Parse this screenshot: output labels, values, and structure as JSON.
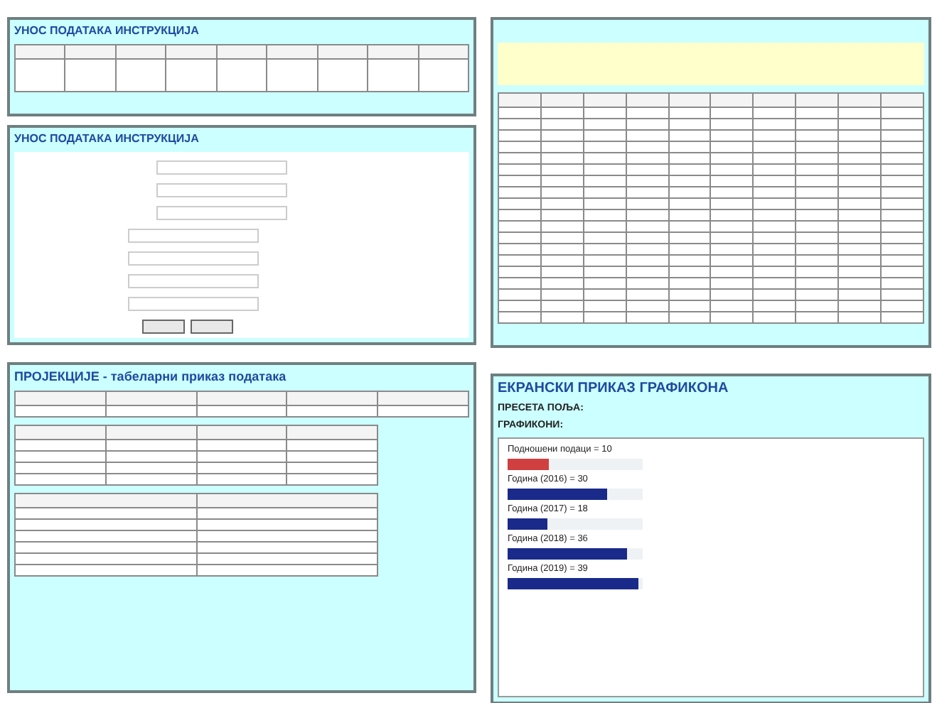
{
  "panels": [
    {
      "kind": "entry-table",
      "title": "УНОС ПОДАТАКА ИНСТРУКЦИЈА"
    },
    {
      "kind": "entry-form",
      "title": "УНОС ПОДАТАКА ИНСТРУКЦИЈА"
    },
    {
      "kind": "report-table"
    },
    {
      "kind": "projections",
      "title": "ПРОЈЕКЦИЈЕ - табеларни приказ података"
    },
    {
      "kind": "charts",
      "title": "ЕКРАНСКИ ПРИКАЗ ГРАФИКОНА",
      "subtitle": "ПРЕСЕТА ПОЉА:",
      "charts_label": "ГРАФИКОНИ:",
      "bars": [
        {
          "label": "Подношени подаци = 10",
          "level": 0.3,
          "color": "#d04040"
        },
        {
          "label": "Година (2016) = 30",
          "level": 0.74,
          "color": "#1a2a8a"
        },
        {
          "label": "Година (2017) = 18",
          "level": 0.29,
          "color": "#1a2a8a"
        },
        {
          "label": "Година (2018) = 36",
          "level": 0.88,
          "color": "#1a2a8a"
        },
        {
          "label": "Година (2019) = 39",
          "level": 0.97,
          "color": "#1a2a8a"
        }
      ]
    }
  ]
}
